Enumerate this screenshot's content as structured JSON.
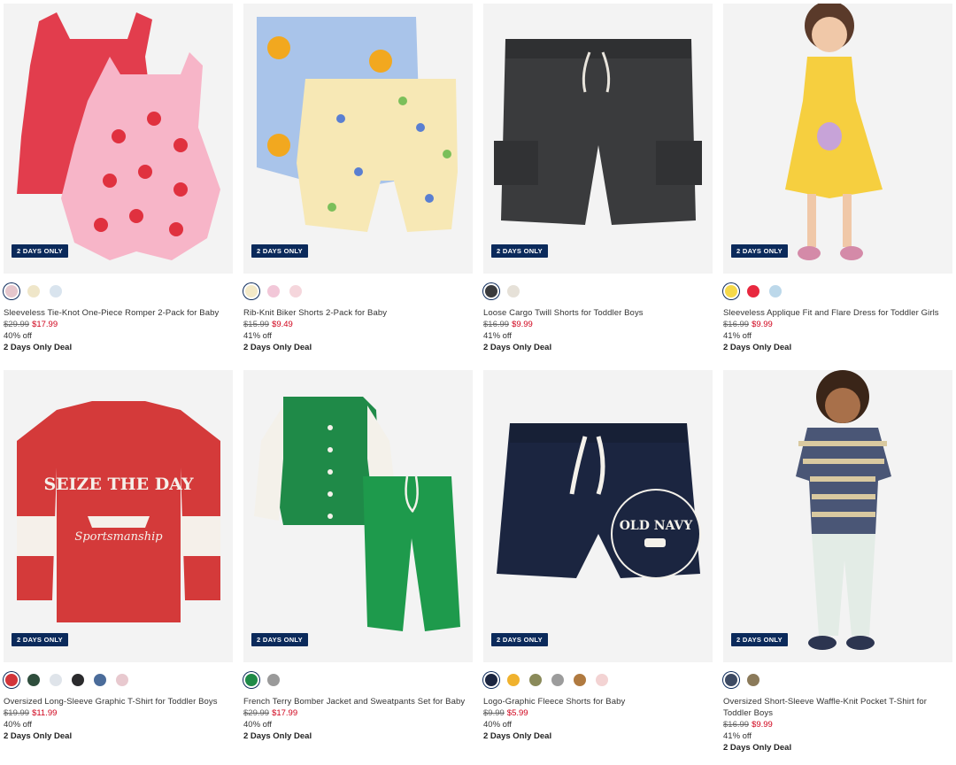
{
  "badge": "2 DAYS ONLY",
  "products": [
    {
      "title": "Sleeveless Tie-Knot One-Piece Romper 2-Pack for Baby",
      "original_price": "$29.99",
      "sale_price": "$17.99",
      "discount": "40% off",
      "deal": "2 Days Only Deal",
      "swatches": [
        "#e5c6cc",
        "#efe6c9",
        "#d9e4ee"
      ],
      "image": "romper-2pack"
    },
    {
      "title": "Rib-Knit Biker Shorts 2-Pack for Baby",
      "original_price": "$15.99",
      "sale_price": "$9.49",
      "discount": "41% off",
      "deal": "2 Days Only Deal",
      "swatches": [
        "#f3e9c7",
        "#f2c7d8",
        "#f5d6dc"
      ],
      "image": "biker-shorts"
    },
    {
      "title": "Loose Cargo Twill Shorts for Toddler Boys",
      "original_price": "$16.99",
      "sale_price": "$9.99",
      "discount": "41% off",
      "deal": "2 Days Only Deal",
      "swatches": [
        "#3a3b3d",
        "#e6e1d8"
      ],
      "image": "cargo-shorts"
    },
    {
      "title": "Sleeveless Applique Fit and Flare Dress for Toddler Girls",
      "original_price": "$16.99",
      "sale_price": "$9.99",
      "discount": "41% off",
      "deal": "2 Days Only Deal",
      "swatches": [
        "#f5d94a",
        "#e8283f",
        "#bcd8ea"
      ],
      "image": "yellow-dress"
    },
    {
      "title": "Oversized Long-Sleeve Graphic T-Shirt for Toddler Boys",
      "original_price": "$19.99",
      "sale_price": "$11.99",
      "discount": "40% off",
      "deal": "2 Days Only Deal",
      "swatches": [
        "#d2343a",
        "#2f4e3d",
        "#dfe4ea",
        "#2b2b2d",
        "#4b6c9a",
        "#e8c9cf"
      ],
      "image": "graphic-tee"
    },
    {
      "title": "French Terry Bomber Jacket and Sweatpants Set for Baby",
      "original_price": "$29.99",
      "sale_price": "$17.99",
      "discount": "40% off",
      "deal": "2 Days Only Deal",
      "swatches": [
        "#1f8a48",
        "#9a9a9a"
      ],
      "image": "bomber-set"
    },
    {
      "title": "Logo-Graphic Fleece Shorts for Baby",
      "original_price": "$9.99",
      "sale_price": "$5.99",
      "discount": "40% off",
      "deal": "2 Days Only Deal",
      "swatches": [
        "#1b2540",
        "#f0b22e",
        "#8a8a5a",
        "#9c9c9c",
        "#b07a40",
        "#f3d3d3"
      ],
      "image": "fleece-shorts"
    },
    {
      "title": "Oversized Short-Sleeve Waffle-Knit Pocket T-Shirt for Toddler Boys",
      "original_price": "$16.99",
      "sale_price": "$9.99",
      "discount": "41% off",
      "deal": "2 Days Only Deal",
      "swatches": [
        "#3d4a63",
        "#8b7a5a"
      ],
      "image": "striped-tee"
    }
  ]
}
